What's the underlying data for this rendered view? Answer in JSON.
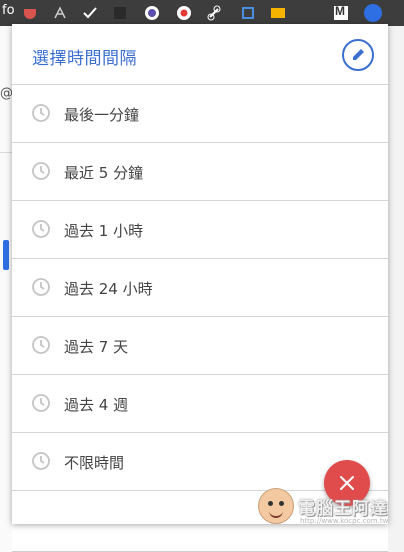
{
  "toolbar": {
    "partial_left_text": "fo",
    "gmail_letter": "M",
    "icons": [
      "pocket-icon",
      "pdf-icon",
      "checkmark-icon",
      "dark-square-icon",
      "globe-icon",
      "record-icon",
      "link-icon",
      "crop-icon",
      "note-icon",
      "gmail-icon",
      "profile-icon"
    ]
  },
  "background": {
    "partial_left_text": "@"
  },
  "dialog": {
    "title": "選擇時間間隔",
    "items": [
      {
        "label": "最後一分鐘"
      },
      {
        "label": "最近 5 分鐘"
      },
      {
        "label": "過去 1 小時"
      },
      {
        "label": "過去 24 小時"
      },
      {
        "label": "過去 7 天"
      },
      {
        "label": "過去 4 週"
      },
      {
        "label": "不限時間"
      }
    ]
  },
  "watermark": {
    "text": "電腦王阿達",
    "url": "http://www.kocpc.com.tw"
  },
  "colors": {
    "accent": "#3b6fd0",
    "fab": "#e04c4c",
    "toolbar": "#3d3d3d"
  }
}
